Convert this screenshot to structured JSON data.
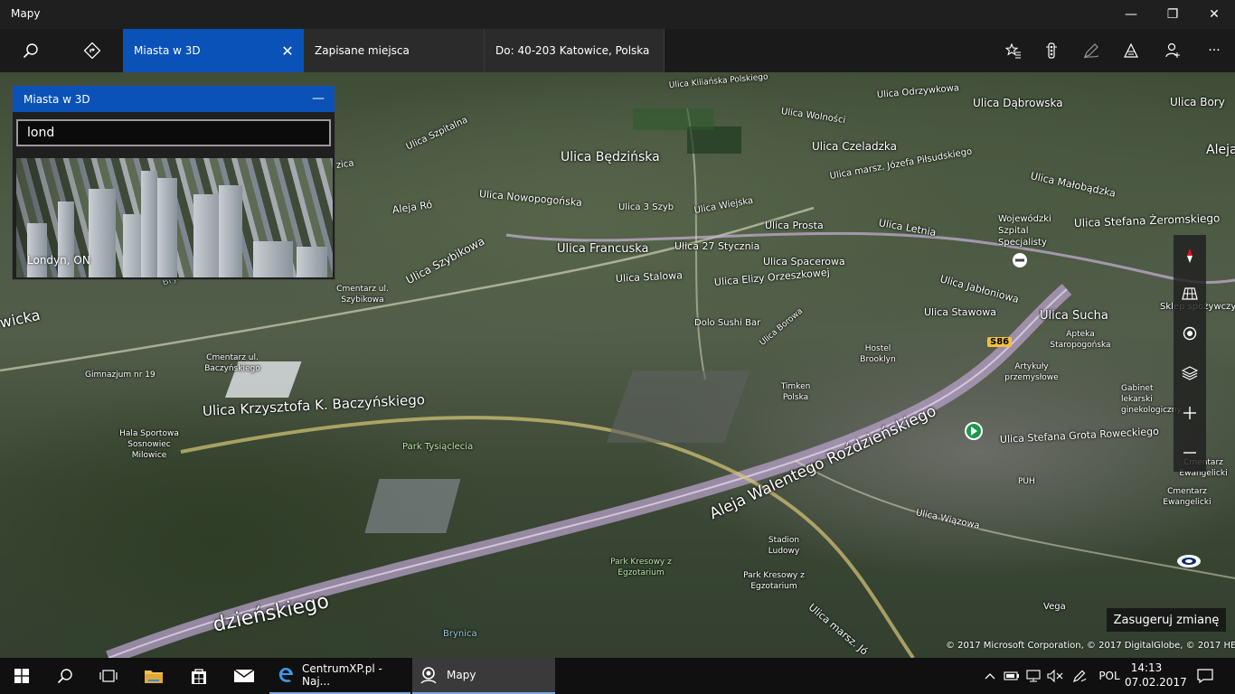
{
  "app": {
    "title": "Mapy"
  },
  "window_controls": {
    "minimize": "—",
    "restore": "❐",
    "close": "✕"
  },
  "toolbar": {
    "tabs": [
      {
        "label": "Miasta w 3D",
        "active": true
      },
      {
        "label": "Zapisane miejsca",
        "active": false
      },
      {
        "label": "Do: 40-203 Katowice, Polska",
        "active": false
      }
    ],
    "close_tab": "✕",
    "more": "···"
  },
  "panel": {
    "title": "Miasta w 3D",
    "minimize": "—",
    "search_value": "lond",
    "result": {
      "name": "Londyn, ON"
    }
  },
  "map": {
    "labels": [
      "Ulica Będzińska",
      "Ulica Czeladzka",
      "Ulica Dąbrowska",
      "Ulica Bory",
      "Aleja Hi",
      "Ulica Odrzywkowa",
      "Ulica Wolności",
      "Ulica marsz. Józefa Piłsudskiego",
      "Ulica Małobądzka",
      "Ulica Szpitalna",
      "Ulica Nowopogońska",
      "Aleja Ró",
      "Ulica 3 Szyb",
      "Ulica Wiejska",
      "Ulica Prosta",
      "Ulica Letnia",
      "Wojewódzki Szpital Specjalisty",
      "Ulica Stefana Żeromskiego",
      "Ulica Francuska",
      "Ulica 27 Stycznia",
      "Ulica Spacerowa",
      "Ulica Stalowa",
      "Ulica Elizy Orzeszkowej",
      "Ulica Jabłoniowa",
      "Ulica Stawowa",
      "Ulica Sucha",
      "Sklep spożywczy",
      "Ulica Szybikowa",
      "Cmentarz ul. Szybikowa",
      "Dolo Sushi Bar",
      "Ulica Borowa",
      "Hostel Brooklyn",
      "Apteka Staropogońska",
      "Artykuły przemysłowe",
      "Gabinet lekarski ginekologiczny",
      "Ulica Stefana Grota Roweckiego",
      "Ulica Krzysztofa K. Baczyńskiego",
      "Park Tysiąclecia",
      "Gimnazjum nr 19",
      "Cmentarz ul. Baczyńskiego",
      "Hala Sportowa Sosnowiec Milowice",
      "Timken Polska",
      "Aleja Walentego Roździeńskiego",
      "Ulica Wiązowa",
      "Stadion Ludowy",
      "Park Kresowy z Egzotarium",
      "Park Kresowy z Egzotarium",
      "Ulica marsz. Jó",
      "dzieńskiego",
      "Brynica",
      "Brynica",
      "wicka",
      "Cmentarz Ewangelicki",
      "Cmentarz Ewangelicki",
      "Vega",
      "PUH",
      "S86",
      "Ulica Kiliańska Polskiego",
      "zica"
    ]
  },
  "suggest": {
    "label": "Zasugeruj zmianę"
  },
  "copyright": "© 2017 Microsoft Corporation, © 2017 DigitalGlobe, © 2017 HERE",
  "taskbar": {
    "items": [
      {
        "label": "CentrumXP.pl - Naj..."
      },
      {
        "label": "Mapy"
      }
    ],
    "language": "POL",
    "time": "14:13",
    "date": "07.02.2017"
  }
}
